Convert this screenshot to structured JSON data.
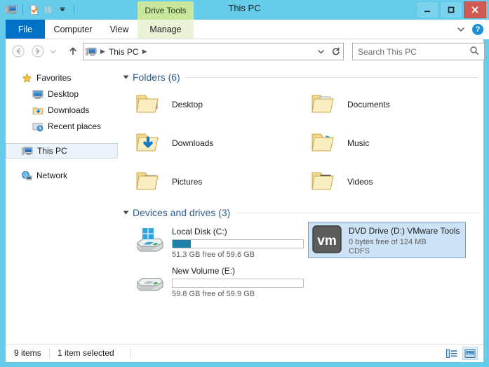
{
  "window": {
    "title": "This PC",
    "contextual_tab": "Drive Tools",
    "accent_color": "#65CDEA",
    "close_color": "#D05A52"
  },
  "quick_access": {
    "items": [
      {
        "name": "this-pc-icon",
        "label": "This PC"
      },
      {
        "name": "properties-icon",
        "label": "Properties"
      },
      {
        "name": "new-folder-icon",
        "label": "New folder"
      },
      {
        "name": "customize-chevron-icon",
        "label": "Customize Quick Access Toolbar"
      }
    ]
  },
  "window_controls": {
    "minimize": "Minimize",
    "maximize": "Maximize",
    "close": "Close"
  },
  "ribbon": {
    "tabs": [
      {
        "label": "File",
        "active": true
      },
      {
        "label": "Computer",
        "active": false
      },
      {
        "label": "View",
        "active": false
      },
      {
        "label": "Manage",
        "active": false
      }
    ],
    "collapse_label": "Minimize the Ribbon",
    "help_label": "?"
  },
  "navbar": {
    "back": "Back",
    "forward": "Forward",
    "recent_locations": "Recent locations",
    "up": "Up one level",
    "address": {
      "icon": "this-pc-icon",
      "crumb": "This PC"
    },
    "dropdown": "Previous locations",
    "refresh": "Refresh",
    "search": {
      "placeholder": "Search This PC",
      "value": ""
    }
  },
  "sidebar": {
    "items": [
      {
        "label": "Favorites",
        "icon": "star-icon",
        "indent": 0,
        "selected": false
      },
      {
        "label": "Desktop",
        "icon": "desktop-icon",
        "indent": 1,
        "selected": false
      },
      {
        "label": "Downloads",
        "icon": "downloads-folder-icon",
        "indent": 1,
        "selected": false
      },
      {
        "label": "Recent places",
        "icon": "recent-places-icon",
        "indent": 1,
        "selected": false
      },
      {
        "label": "This PC",
        "icon": "this-pc-icon",
        "indent": 0,
        "selected": true
      },
      {
        "label": "Network",
        "icon": "network-icon",
        "indent": 0,
        "selected": false
      }
    ]
  },
  "main": {
    "folders_section": {
      "label": "Folders (6)",
      "count": 6,
      "expanded": true,
      "items": [
        {
          "label": "Desktop",
          "icon": "desktop-folder-icon"
        },
        {
          "label": "Documents",
          "icon": "documents-folder-icon"
        },
        {
          "label": "Downloads",
          "icon": "downloads-folder-icon"
        },
        {
          "label": "Music",
          "icon": "music-folder-icon"
        },
        {
          "label": "Pictures",
          "icon": "pictures-folder-icon"
        },
        {
          "label": "Videos",
          "icon": "videos-folder-icon"
        }
      ]
    },
    "drives_section": {
      "label": "Devices and drives (3)",
      "count": 3,
      "expanded": true,
      "items": [
        {
          "name": "Local Disk (C:)",
          "icon": "windows-drive-icon",
          "capacity_text": "51.3 GB free of 59.6 GB",
          "extra_text": "",
          "used_percent": 14,
          "has_bar": true,
          "selected": false
        },
        {
          "name": "DVD Drive (D:) VMware Tools",
          "icon": "vmware-dvd-icon",
          "capacity_text": "0 bytes free of 124 MB",
          "extra_text": "CDFS",
          "used_percent": 100,
          "has_bar": false,
          "selected": true
        },
        {
          "name": "New Volume (E:)",
          "icon": "drive-icon",
          "capacity_text": "59.8 GB free of 59.9 GB",
          "extra_text": "",
          "used_percent": 0,
          "has_bar": true,
          "selected": false
        }
      ]
    }
  },
  "statusbar": {
    "item_count": "9 items",
    "selection": "1 item selected",
    "views": [
      {
        "name": "details-view-icon",
        "label": "Details view",
        "active": false
      },
      {
        "name": "large-icons-view-icon",
        "label": "Large icons view",
        "active": true
      }
    ]
  }
}
